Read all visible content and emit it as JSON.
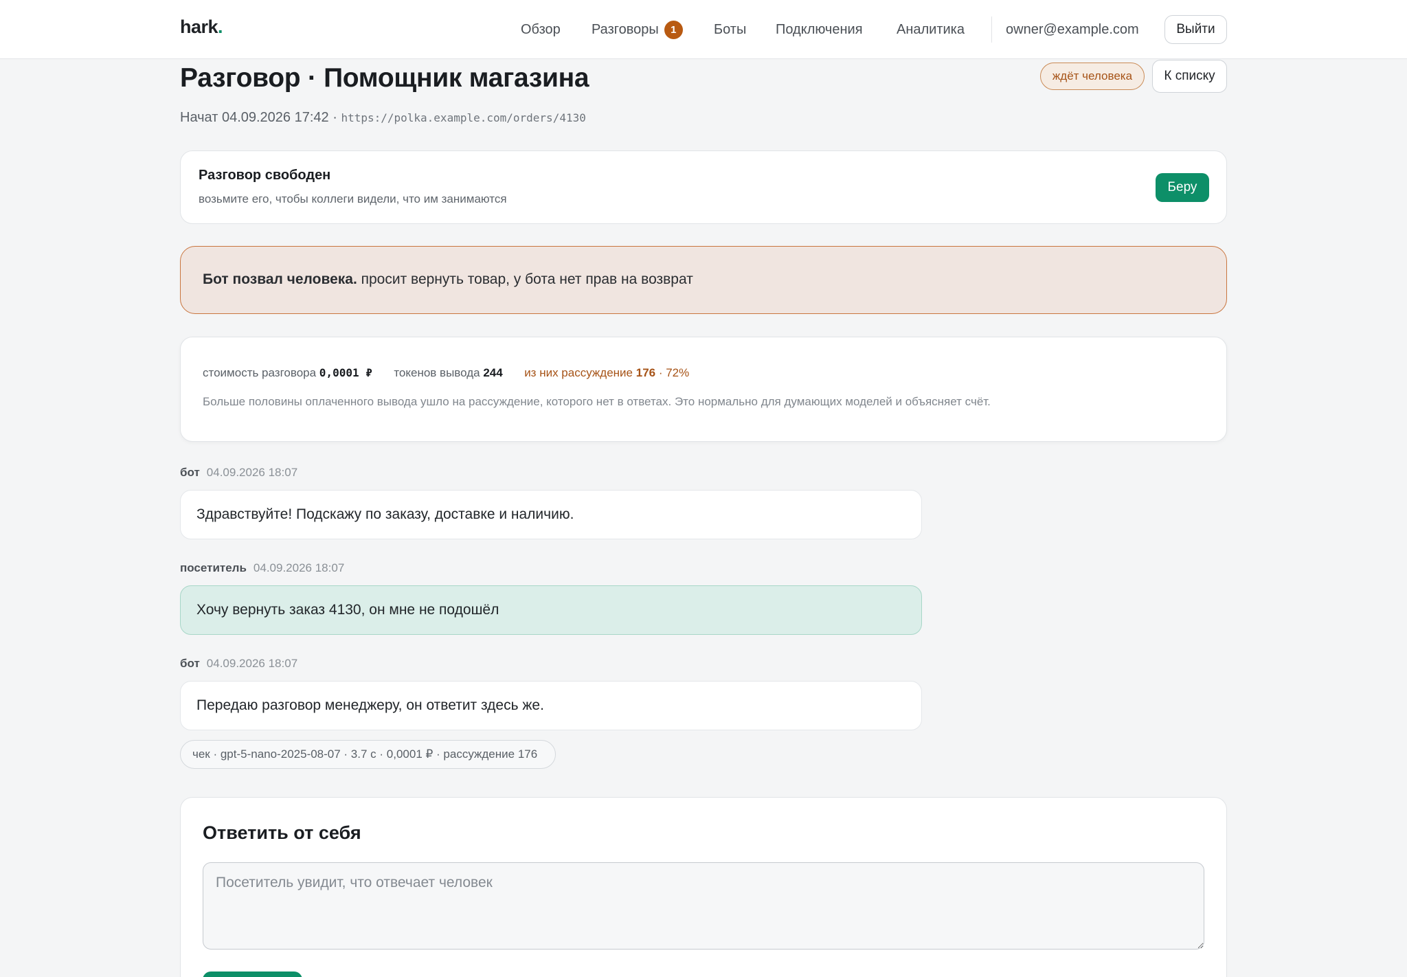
{
  "brand": {
    "name": "hark",
    "dot": "."
  },
  "nav": {
    "items": [
      {
        "label": "Обзор"
      },
      {
        "label": "Разговоры",
        "badge": "1"
      },
      {
        "label": "Боты"
      },
      {
        "label": "Подключения"
      },
      {
        "label": "Аналитика"
      }
    ],
    "user_email": "owner@example.com",
    "logout_label": "Выйти"
  },
  "header": {
    "title": "Разговор · Помощник магазина",
    "started": "Начат 04.09.2026 17:42 · ",
    "url": "https://polka.example.com/orders/4130",
    "status": "ждёт человека",
    "back_label": "К списку"
  },
  "claim": {
    "title": "Разговор свободен",
    "description": "возьмите его, чтобы коллеги видели, что им занимаются",
    "button_label": "Беру"
  },
  "alert": {
    "bold": "Бот позвал человека.",
    "text": " просит вернуть товар, у бота нет прав на возврат"
  },
  "stats": {
    "cost_label": "стоимость разговора",
    "cost_value": "0,0001 ₽",
    "tokens_label": "токенов вывода",
    "tokens_value": "244",
    "reasoning_label": "из них рассуждение",
    "reasoning_value": "176",
    "reasoning_share": " · 72%",
    "note": "Больше половины оплаченного вывода ушло на рассуждение, которого нет в ответах. Это нормально для думающих моделей и объясняет счёт."
  },
  "messages": [
    {
      "author": "бот",
      "time": "04.09.2026 18:07",
      "text": "Здравствуйте! Подскажу по заказу, доставке и наличию.",
      "role": "bot"
    },
    {
      "author": "посетитель",
      "time": "04.09.2026 18:07",
      "text": "Хочу вернуть заказ 4130, он мне не подошёл",
      "role": "visitor"
    },
    {
      "author": "бот",
      "time": "04.09.2026 18:07",
      "text": "Передаю разговор менеджеру, он ответит здесь же.",
      "role": "bot"
    }
  ],
  "receipt": "чек · gpt-5-nano-2025-08-07 · 3.7 с · 0,0001 ₽ · рассуждение 176",
  "reply": {
    "title": "Ответить от себя",
    "placeholder": "Посетитель увидит, что отвечает человек"
  },
  "colors": {
    "accent": "#0d8f68",
    "warning": "#a65317",
    "visitor_bubble": "#dbeee9",
    "alert_bg": "#f0e5e0"
  }
}
